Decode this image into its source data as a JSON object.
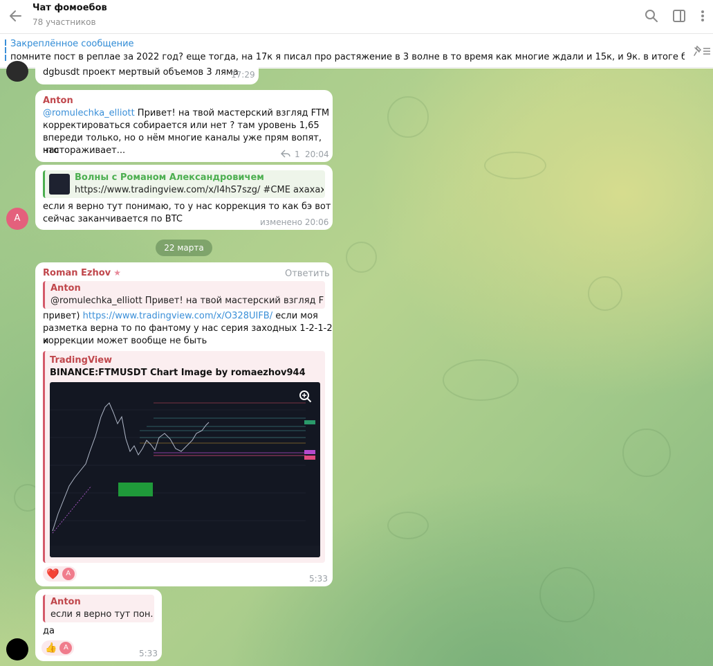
{
  "header": {
    "title": "Чат фомоебов",
    "subtitle": "78 участников"
  },
  "pinned": {
    "title": "Закреплённое сообщение",
    "text": "помните пост в реплае за 2022 год? еще тогда, на 17к я писал про растяжение в 3 волне в то время как многие ждали и 15к, и 9к. в итоге биток пробил АТ..."
  },
  "messages": {
    "m1": {
      "text": "dgbusdt проект мертвый объемов 3 ляма",
      "time": "17:29"
    },
    "m2": {
      "sender": "Anton",
      "mention": "@romulechka_elliott",
      "line1": " Привет! на твой мастерский взгляд FTM",
      "line2": "корректироваться собирается или нет ? там уровень 1,65",
      "line3": "впереди только, но о нём многие каналы уже прям вопят, что",
      "line4": "настораживает...",
      "replies": "1",
      "time": "20:04"
    },
    "m3": {
      "preview_title": "Волны с Романом Александровичем",
      "preview_text": "https://www.tradingview.com/x/I4hS7szg/ #CME ахахах, я...",
      "line1": "если я верно тут понимаю, то у нас коррекция то как бэ вот",
      "line2": "сейчас заканчивается по BTC",
      "edited": "изменено 20:06",
      "avatar_letter": "A"
    },
    "date": "22 марта",
    "m4": {
      "sender": "Roman Ezhov",
      "reply_label": "Ответить",
      "quote_name": "Anton",
      "quote_text": "@romulechka_elliott Привет! на твой мастерский взгляд FTM к...",
      "text_pre": "привет) ",
      "link": "https://www.tradingview.com/x/O328UIFB/",
      "text_post": " если  моя",
      "line2": "разметка верна то по фантому у нас серия заходных 1-2-1-2 и",
      "line3": "коррекции может вообще не быть",
      "card_site": "TradingView",
      "card_title": "BINANCE:FTMUSDT Chart Image by romaezhov944",
      "reaction_emoji": "❤️",
      "reaction_letter": "A",
      "time": "5:33"
    },
    "m5": {
      "quote_name": "Anton",
      "quote_text": "если я верно тут пон...",
      "text": "да",
      "reaction_emoji": "👍",
      "reaction_letter": "A",
      "time": "5:33"
    }
  },
  "colors": {
    "accent": "#3a8fd8",
    "sender": "#c0474c",
    "avatar_pink": "#e4607c"
  }
}
